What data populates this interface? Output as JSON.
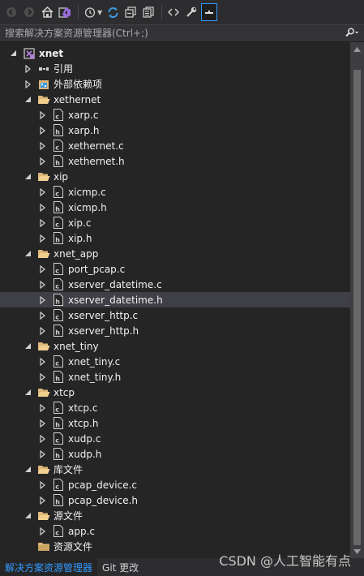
{
  "toolbar": {
    "buttons": [
      "back-icon",
      "forward-icon",
      "home-icon",
      "vs-icon",
      "history-icon",
      "sync-icon",
      "collapse-all-icon",
      "copy-icon",
      "code-icon",
      "properties-icon",
      "preview-icon"
    ]
  },
  "search": {
    "placeholder": "搜索解决方案资源管理器(Ctrl+;)"
  },
  "tree": [
    {
      "label": "xnet",
      "level": 0,
      "expand": "open",
      "icon": "project",
      "bold": true
    },
    {
      "label": "引用",
      "level": 1,
      "expand": "closed",
      "icon": "references"
    },
    {
      "label": "外部依赖项",
      "level": 1,
      "expand": "closed",
      "icon": "external"
    },
    {
      "label": "xethernet",
      "level": 1,
      "expand": "open",
      "icon": "folder-open"
    },
    {
      "label": "xarp.c",
      "level": 2,
      "expand": "closed",
      "icon": "c-file"
    },
    {
      "label": "xarp.h",
      "level": 2,
      "expand": "closed",
      "icon": "h-file"
    },
    {
      "label": "xethernet.c",
      "level": 2,
      "expand": "closed",
      "icon": "c-file"
    },
    {
      "label": "xethernet.h",
      "level": 2,
      "expand": "closed",
      "icon": "h-file"
    },
    {
      "label": "xip",
      "level": 1,
      "expand": "open",
      "icon": "folder-open"
    },
    {
      "label": "xicmp.c",
      "level": 2,
      "expand": "closed",
      "icon": "c-file"
    },
    {
      "label": "xicmp.h",
      "level": 2,
      "expand": "closed",
      "icon": "h-file"
    },
    {
      "label": "xip.c",
      "level": 2,
      "expand": "closed",
      "icon": "c-file"
    },
    {
      "label": "xip.h",
      "level": 2,
      "expand": "closed",
      "icon": "h-file"
    },
    {
      "label": "xnet_app",
      "level": 1,
      "expand": "open",
      "icon": "folder-open"
    },
    {
      "label": "port_pcap.c",
      "level": 2,
      "expand": "closed",
      "icon": "c-file"
    },
    {
      "label": "xserver_datetime.c",
      "level": 2,
      "expand": "closed",
      "icon": "c-file"
    },
    {
      "label": "xserver_datetime.h",
      "level": 2,
      "expand": "closed",
      "icon": "h-file",
      "selected": true
    },
    {
      "label": "xserver_http.c",
      "level": 2,
      "expand": "closed",
      "icon": "c-file"
    },
    {
      "label": "xserver_http.h",
      "level": 2,
      "expand": "closed",
      "icon": "h-file"
    },
    {
      "label": "xnet_tiny",
      "level": 1,
      "expand": "open",
      "icon": "folder-open"
    },
    {
      "label": "xnet_tiny.c",
      "level": 2,
      "expand": "closed",
      "icon": "c-file"
    },
    {
      "label": "xnet_tiny.h",
      "level": 2,
      "expand": "closed",
      "icon": "h-file"
    },
    {
      "label": "xtcp",
      "level": 1,
      "expand": "open",
      "icon": "folder-open"
    },
    {
      "label": "xtcp.c",
      "level": 2,
      "expand": "closed",
      "icon": "c-file"
    },
    {
      "label": "xtcp.h",
      "level": 2,
      "expand": "closed",
      "icon": "h-file"
    },
    {
      "label": "xudp.c",
      "level": 2,
      "expand": "closed",
      "icon": "c-file"
    },
    {
      "label": "xudp.h",
      "level": 2,
      "expand": "closed",
      "icon": "h-file"
    },
    {
      "label": "库文件",
      "level": 1,
      "expand": "open",
      "icon": "folder-open"
    },
    {
      "label": "pcap_device.c",
      "level": 2,
      "expand": "closed",
      "icon": "c-file"
    },
    {
      "label": "pcap_device.h",
      "level": 2,
      "expand": "closed",
      "icon": "h-file"
    },
    {
      "label": "源文件",
      "level": 1,
      "expand": "open",
      "icon": "folder-open"
    },
    {
      "label": "app.c",
      "level": 2,
      "expand": "closed",
      "icon": "c-file"
    },
    {
      "label": "资源文件",
      "level": 1,
      "expand": "none",
      "icon": "folder-closed"
    }
  ],
  "bottom_tabs": [
    {
      "label": "解决方案资源管理器",
      "active": true
    },
    {
      "label": "Git 更改",
      "active": false
    }
  ],
  "watermark": "CSDN @人工智能有点",
  "colors": {
    "background": "#252526",
    "selected": "#3f3f46",
    "accent": "#3399ff",
    "folder": "#dcb67a",
    "project": "#b180d7"
  }
}
